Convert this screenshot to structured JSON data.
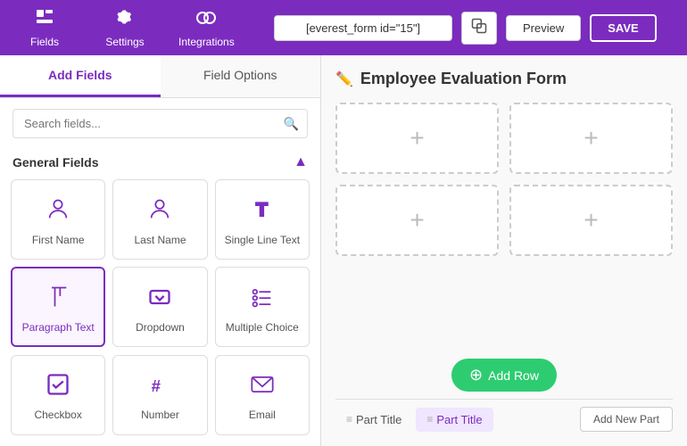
{
  "topNav": {
    "fields_label": "Fields",
    "settings_label": "Settings",
    "integrations_label": "Integrations",
    "shortcode": "[everest_form id=\"15\"]",
    "preview_label": "Preview",
    "save_label": "SAVE"
  },
  "leftPanel": {
    "tab_add_fields": "Add Fields",
    "tab_field_options": "Field Options",
    "search_placeholder": "Search fields...",
    "section_title": "General Fields",
    "fields": [
      {
        "id": "first-name",
        "label": "First Name",
        "icon": "👤"
      },
      {
        "id": "last-name",
        "label": "Last Name",
        "icon": "👤"
      },
      {
        "id": "single-line",
        "label": "Single Line Text",
        "icon": "T"
      },
      {
        "id": "paragraph",
        "label": "Paragraph Text",
        "icon": "¶",
        "active": true
      },
      {
        "id": "dropdown",
        "label": "Dropdown",
        "icon": "▾"
      },
      {
        "id": "multiple-choice",
        "label": "Multiple Choice",
        "icon": "☰"
      },
      {
        "id": "checkbox",
        "label": "Checkbox",
        "icon": "☑"
      },
      {
        "id": "number",
        "label": "Number",
        "icon": "#"
      },
      {
        "id": "email",
        "label": "Email",
        "icon": "✉"
      }
    ]
  },
  "rightPanel": {
    "form_title": "Employee Evaluation Form",
    "add_row_label": "Add Row",
    "part_titles": [
      {
        "id": "part1",
        "label": "Part Title",
        "active": false
      },
      {
        "id": "part2",
        "label": "Part Title",
        "active": true
      }
    ],
    "add_new_part_label": "Add New Part"
  }
}
